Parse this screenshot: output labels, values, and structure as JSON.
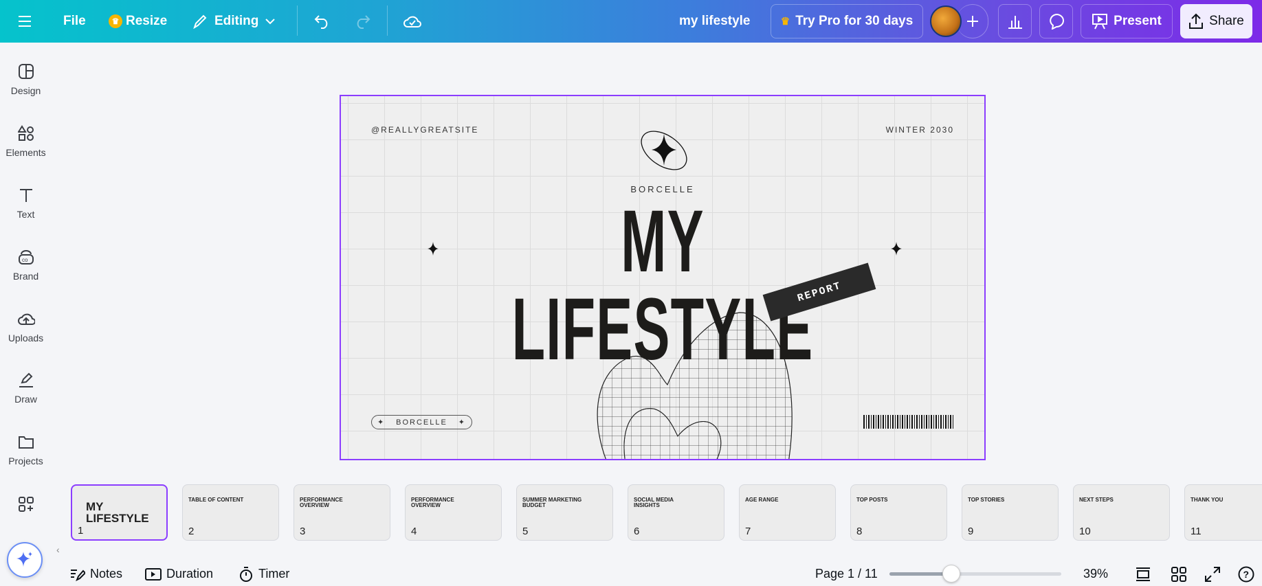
{
  "topbar": {
    "menu_icon": "hamburger-icon",
    "file": "File",
    "resize": "Resize",
    "editing": "Editing",
    "doc_title": "my lifestyle",
    "try_pro": "Try Pro for 30 days",
    "present": "Present",
    "share": "Share"
  },
  "sidebar": {
    "items": [
      {
        "label": "Design",
        "icon": "layout-icon"
      },
      {
        "label": "Elements",
        "icon": "shapes-icon"
      },
      {
        "label": "Text",
        "icon": "text-icon"
      },
      {
        "label": "Brand",
        "icon": "brand-icon"
      },
      {
        "label": "Uploads",
        "icon": "upload-cloud-icon"
      },
      {
        "label": "Draw",
        "icon": "draw-icon"
      },
      {
        "label": "Projects",
        "icon": "folder-icon"
      },
      {
        "label": "",
        "icon": "apps-icon"
      }
    ]
  },
  "slide": {
    "handle": "@REALLYGREATSITE",
    "season": "WINTER 2030",
    "brand": "BORCELLE",
    "title": "MY LIFESTYLE",
    "tag": "REPORT",
    "pill_brand": "BORCELLE"
  },
  "thumbnails": [
    {
      "num": "1",
      "title": "MY LIFESTYLE"
    },
    {
      "num": "2",
      "title": "TABLE OF CONTENT"
    },
    {
      "num": "3",
      "title": "PERFORMANCE OVERVIEW"
    },
    {
      "num": "4",
      "title": "PERFORMANCE OVERVIEW"
    },
    {
      "num": "5",
      "title": "SUMMER MARKETING BUDGET"
    },
    {
      "num": "6",
      "title": "SOCIAL MEDIA INSIGHTS"
    },
    {
      "num": "7",
      "title": "AGE RANGE"
    },
    {
      "num": "8",
      "title": "TOP POSTS"
    },
    {
      "num": "9",
      "title": "TOP STORIES"
    },
    {
      "num": "10",
      "title": "NEXT STEPS"
    },
    {
      "num": "11",
      "title": "THANK YOU"
    }
  ],
  "footer": {
    "notes": "Notes",
    "duration": "Duration",
    "timer": "Timer",
    "page": "Page 1 / 11",
    "zoom": "39%",
    "zoom_value": 39
  },
  "colors": {
    "accent": "#8b3dff",
    "crown": "#f7b500"
  }
}
